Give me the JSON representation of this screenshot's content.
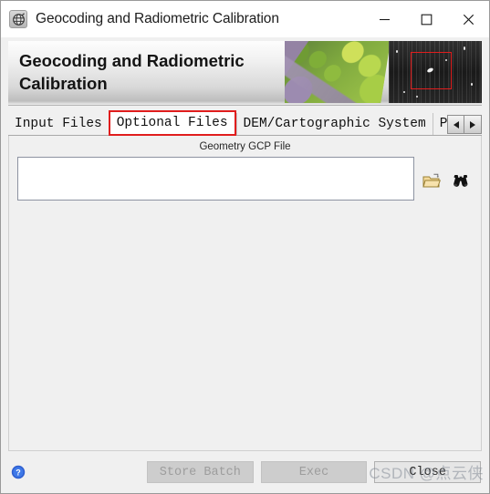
{
  "window": {
    "title": "Geocoding and Radiometric Calibration",
    "app_icon": "globe-icon",
    "controls": {
      "minimize": "minimize-icon",
      "maximize": "maximize-icon",
      "close": "close-icon"
    }
  },
  "banner": {
    "title": "Geocoding and Radiometric Calibration",
    "image": "aerial-and-sar-imagery",
    "highlight_box_color": "#e01d1d"
  },
  "tabs": {
    "items": [
      {
        "label": "Input Files",
        "selected": false
      },
      {
        "label": "Optional Files",
        "selected": true
      },
      {
        "label": "DEM/Cartographic System",
        "selected": false
      },
      {
        "label": "Paramet",
        "selected": false
      }
    ],
    "selected_border_color": "#e01d1d",
    "scroll_left": "arrow-left-icon",
    "scroll_right": "arrow-right-icon"
  },
  "optional_files": {
    "gcp_label": "Geometry GCP File",
    "gcp_value": "",
    "gcp_placeholder": "",
    "browse_icon": "folder-open-icon",
    "search_icon": "binoculars-icon"
  },
  "footer": {
    "help_icon": "help-icon",
    "buttons": [
      {
        "label": "Store Batch",
        "enabled": false
      },
      {
        "label": "Exec",
        "enabled": false
      },
      {
        "label": "Close",
        "enabled": true
      }
    ],
    "watermark": "CSDN @点云侠"
  }
}
